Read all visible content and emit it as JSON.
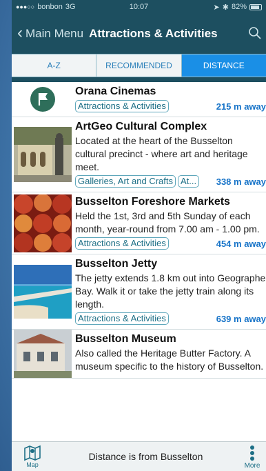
{
  "status": {
    "carrier": "bonbon",
    "network": "3G",
    "time": "10:07",
    "battery": "82%"
  },
  "nav": {
    "back_label": "Main Menu",
    "title": "Attractions & Activities"
  },
  "tabs": [
    {
      "label": "A-Z",
      "active": false
    },
    {
      "label": "RECOMMENDED",
      "active": false
    },
    {
      "label": "DISTANCE",
      "active": true
    }
  ],
  "items": [
    {
      "title": "Orana Cinemas",
      "description": "",
      "tags": [
        "Attractions & Activities"
      ],
      "distance": "215 m away",
      "thumb": "flag-icon"
    },
    {
      "title": "ArtGeo Cultural Complex",
      "description": "Located at the heart of the Busselton cultural precinct - where art and heritage meet.",
      "tags": [
        "Galleries, Art and Crafts",
        "At..."
      ],
      "distance": "338 m away",
      "thumb": "building-photo"
    },
    {
      "title": "Busselton Foreshore Markets",
      "description": "Held the 1st, 3rd and 5th Sunday of each month, year-round from 7.00 am - 1.00 pm.",
      "tags": [
        "Attractions & Activities"
      ],
      "distance": "454 m away",
      "thumb": "apples-photo"
    },
    {
      "title": "Busselton Jetty",
      "description": "The jetty extends 1.8 km out into Geographe Bay. Walk it or take the jetty train along its length.",
      "tags": [
        "Attractions & Activities"
      ],
      "distance": "639 m away",
      "thumb": "jetty-photo"
    },
    {
      "title": "Busselton Museum",
      "description": "Also called the Heritage Butter Factory. A museum specific to the history of Busselton.",
      "tags": [],
      "distance": "",
      "thumb": "museum-photo"
    }
  ],
  "bottom": {
    "map_label": "Map",
    "info_text": "Distance is from Busselton",
    "more_label": "More"
  },
  "colors": {
    "header": "#1d4f60",
    "active_tab": "#1a8fe6",
    "distance": "#1673c8",
    "tag_border": "#5fa7bb"
  }
}
